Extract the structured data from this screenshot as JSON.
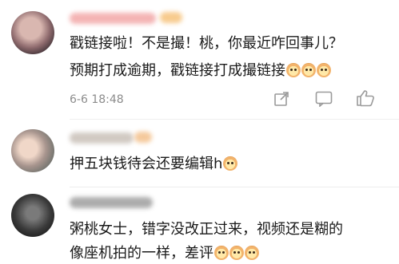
{
  "comments": [
    {
      "line1": "戳链接啦！不是撮！桃，你最近咋回事儿？",
      "line2": "预期打成逾期，戳链接打成撮链接",
      "emoji_count": 3,
      "timestamp": "6-6 18:48",
      "actions": [
        "share-icon",
        "comment-icon",
        "like-icon"
      ]
    },
    {
      "line1": "押五块钱待会还要编辑h",
      "emoji_count": 1
    },
    {
      "line1": "粥桃女士，错字没改正过来，视频还是糊的",
      "line2": "像座机拍的一样，差评",
      "emoji_count": 3
    }
  ],
  "colors": {
    "text": "#1a1a1a",
    "meta": "#8c8c8c",
    "icon": "#9a9a9a"
  }
}
